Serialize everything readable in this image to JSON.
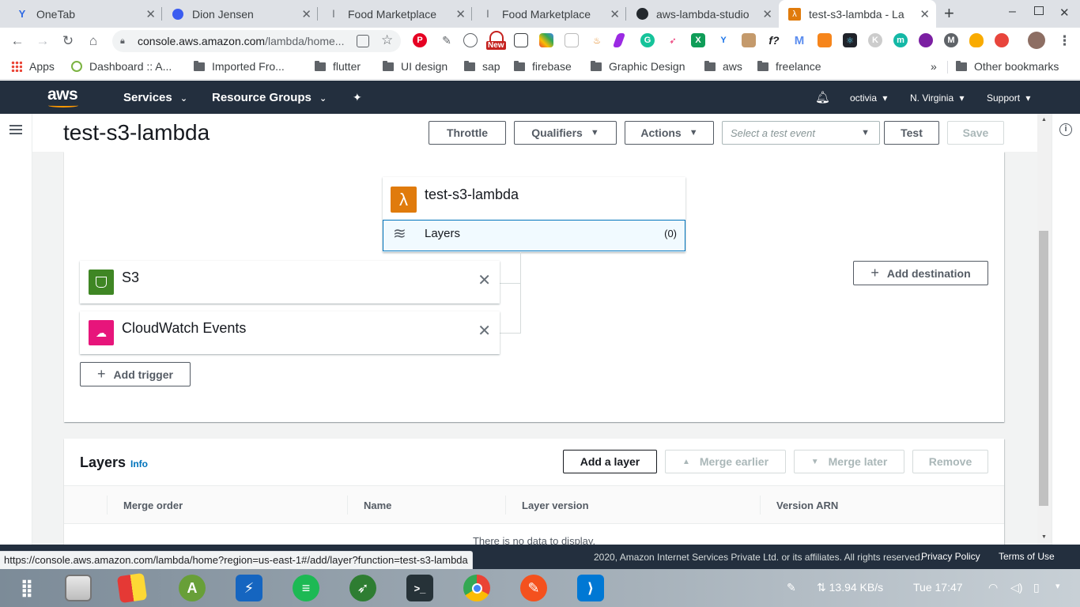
{
  "browser": {
    "tabs": [
      {
        "title": "OneTab",
        "icon": "onetab-icon",
        "icon_color": "#2f6ae3"
      },
      {
        "title": "Dion Jensen",
        "icon": "messenger-icon",
        "icon_color": "#3b5cf0"
      },
      {
        "title": "Food Marketplace",
        "icon": "flutter-icon",
        "icon_color": "#5f6368"
      },
      {
        "title": "Food Marketplace",
        "icon": "flutter-icon",
        "icon_color": "#5f6368"
      },
      {
        "title": "aws-lambda-studio",
        "icon": "github-icon",
        "icon_color": "#24292e"
      },
      {
        "title": "test-s3-lambda - La",
        "icon": "lambda-icon",
        "icon_color": "#e07b0c"
      }
    ],
    "new_tab_label": "+",
    "window_controls": [
      "minimize",
      "maximize",
      "close"
    ],
    "omnibox": {
      "host": "console.aws.amazon.com",
      "path": "/lambda/home..."
    },
    "bookmarks": [
      {
        "label": "Apps",
        "icon": "apps-grid-icon"
      },
      {
        "label": "Dashboard :: A...",
        "icon": "dashboard-icon"
      },
      {
        "label": "Imported Fro...",
        "icon": "folder-icon"
      },
      {
        "label": "flutter",
        "icon": "folder-icon"
      },
      {
        "label": "UI design",
        "icon": "folder-icon"
      },
      {
        "label": "sap",
        "icon": "folder-icon"
      },
      {
        "label": "firebase",
        "icon": "folder-icon"
      },
      {
        "label": "Graphic Design",
        "icon": "folder-icon"
      },
      {
        "label": "aws",
        "icon": "folder-icon"
      },
      {
        "label": "freelance",
        "icon": "folder-icon"
      }
    ],
    "bookmarks_overflow": "»",
    "other_bookmarks": "Other bookmarks",
    "extension_new_badge": "New",
    "status_url": "https://console.aws.amazon.com/lambda/home?region=us-east-1#/add/layer?function=test-s3-lambda"
  },
  "aws_nav": {
    "logo": "aws",
    "services": "Services",
    "resource_groups": "Resource Groups",
    "user": "octivia",
    "region": "N. Virginia",
    "support": "Support"
  },
  "function": {
    "name": "test-s3-lambda",
    "buttons": {
      "throttle": "Throttle",
      "qualifiers": "Qualifiers",
      "actions": "Actions",
      "test_event_placeholder": "Select a test event",
      "test": "Test",
      "save": "Save"
    }
  },
  "designer": {
    "function_name": "test-s3-lambda",
    "layers_label": "Layers",
    "layers_count": "(0)",
    "triggers": [
      {
        "name": "S3",
        "icon": "s3-bucket-icon",
        "color": "#3f8624"
      },
      {
        "name": "CloudWatch Events",
        "icon": "cloudwatch-events-icon",
        "color": "#e7157b"
      }
    ],
    "add_trigger": "Add trigger",
    "add_destination": "Add destination"
  },
  "layers_panel": {
    "title": "Layers",
    "info": "Info",
    "buttons": {
      "add": "Add a layer",
      "merge_earlier": "Merge earlier",
      "merge_later": "Merge later",
      "remove": "Remove"
    },
    "columns": [
      "Merge order",
      "Name",
      "Layer version",
      "Version ARN"
    ],
    "empty_text": "There is no data to display."
  },
  "footer": {
    "copyright": "2020, Amazon Internet Services Private Ltd. or its affiliates. All rights reserved.",
    "privacy": "Privacy Policy",
    "terms": "Terms of Use"
  },
  "taskbar": {
    "network_speed": "13.94 KB/s",
    "clock": "Tue 17:47"
  },
  "colors": {
    "aws_nav_bg": "#232f3e",
    "lambda_orange": "#e07b0c",
    "link_blue": "#0073bb",
    "selected_layer_bg": "#f1faff"
  }
}
